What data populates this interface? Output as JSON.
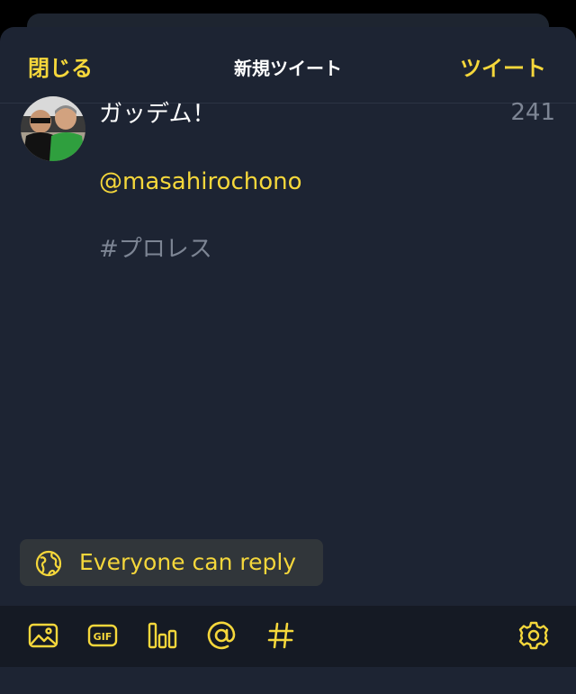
{
  "nav": {
    "close_label": "閉じる",
    "title": "新規ツイート",
    "tweet_label": "ツイート"
  },
  "compose": {
    "line1": "ガッデム！",
    "mention": "@masahirochono",
    "hashtag": "#プロレス",
    "remaining_count": "241"
  },
  "reply_setting": {
    "label": "Everyone can reply",
    "icon": "globe-icon"
  },
  "toolbar": {
    "icons": [
      "image-icon",
      "gif-icon",
      "poll-icon",
      "mention-icon",
      "hashtag-icon",
      "settings-icon"
    ],
    "gif_text": "GIF"
  },
  "colors": {
    "accent": "#f5d73b",
    "background": "#1d2433",
    "muted_text": "#7d8594",
    "toolbar_bg": "#151a24"
  }
}
